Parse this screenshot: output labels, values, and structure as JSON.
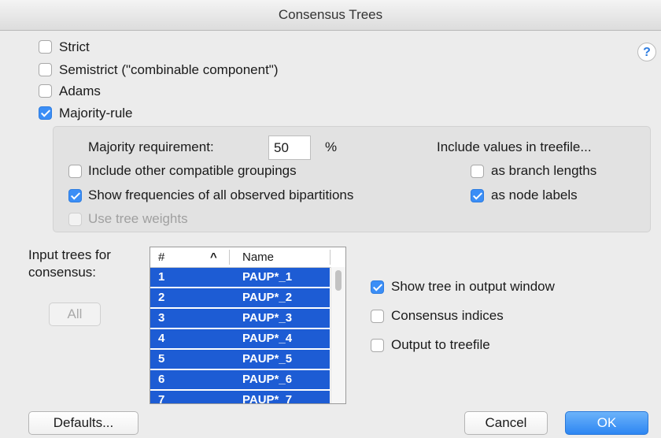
{
  "window": {
    "title": "Consensus Trees"
  },
  "help_label": "?",
  "methods": [
    {
      "label": "Strict",
      "checked": false
    },
    {
      "label": "Semistrict (\"combinable component\")",
      "checked": false
    },
    {
      "label": "Adams",
      "checked": false
    },
    {
      "label": "Majority-rule",
      "checked": true
    }
  ],
  "majority": {
    "requirement_label": "Majority requirement:",
    "requirement_value": "50",
    "percent": "%",
    "include_other": {
      "label": "Include other compatible groupings",
      "checked": false
    },
    "show_freq": {
      "label": "Show frequencies of all observed bipartitions",
      "checked": true
    },
    "use_weights": {
      "label": "Use tree weights",
      "checked": false,
      "disabled": true
    },
    "include_values_label": "Include values in treefile...",
    "branch_lengths": {
      "label": "as branch lengths",
      "checked": false
    },
    "node_labels": {
      "label": "as node labels",
      "checked": true
    }
  },
  "input": {
    "label_line1": "Input trees for",
    "label_line2": "consensus:",
    "all_button": "All",
    "columns": {
      "num": "#",
      "sort": "^",
      "name": "Name"
    },
    "rows": [
      {
        "num": "1",
        "name": "PAUP*_1"
      },
      {
        "num": "2",
        "name": "PAUP*_2"
      },
      {
        "num": "3",
        "name": "PAUP*_3"
      },
      {
        "num": "4",
        "name": "PAUP*_4"
      },
      {
        "num": "5",
        "name": "PAUP*_5"
      },
      {
        "num": "6",
        "name": "PAUP*_6"
      },
      {
        "num": "7",
        "name": "PAUP*_7"
      }
    ]
  },
  "output": {
    "show_tree": {
      "label": "Show tree in output window",
      "checked": true
    },
    "indices": {
      "label": "Consensus indices",
      "checked": false
    },
    "treefile": {
      "label": "Output to treefile",
      "checked": false
    }
  },
  "buttons": {
    "defaults": "Defaults...",
    "cancel": "Cancel",
    "ok": "OK"
  },
  "colors": {
    "accent": "#3b8ef6",
    "selection": "#1d5cd4"
  }
}
